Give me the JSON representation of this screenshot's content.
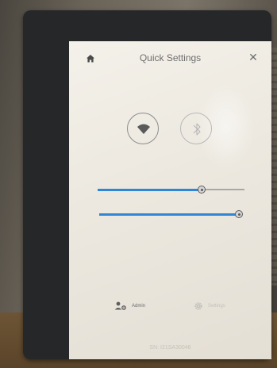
{
  "header": {
    "title": "Quick Settings",
    "home_icon": "home-icon",
    "close_symbol": "✕"
  },
  "toggles": [
    {
      "name": "wifi",
      "icon": "wifi-icon",
      "state": "on"
    },
    {
      "name": "bluetooth",
      "icon": "bluetooth-icon",
      "state": "off"
    }
  ],
  "sliders": [
    {
      "name": "slider-1",
      "level_fraction": 0.71
    },
    {
      "name": "slider-2",
      "level_fraction": 0.98
    }
  ],
  "footer": {
    "admin_label": "Admin",
    "settings_label": "Settings"
  },
  "device": {
    "serial": "SN: I21SA30046"
  },
  "colors": {
    "accent": "#2f86d6",
    "icon_dark": "#6e6e6e",
    "icon_faded": "#c2c0ba"
  }
}
